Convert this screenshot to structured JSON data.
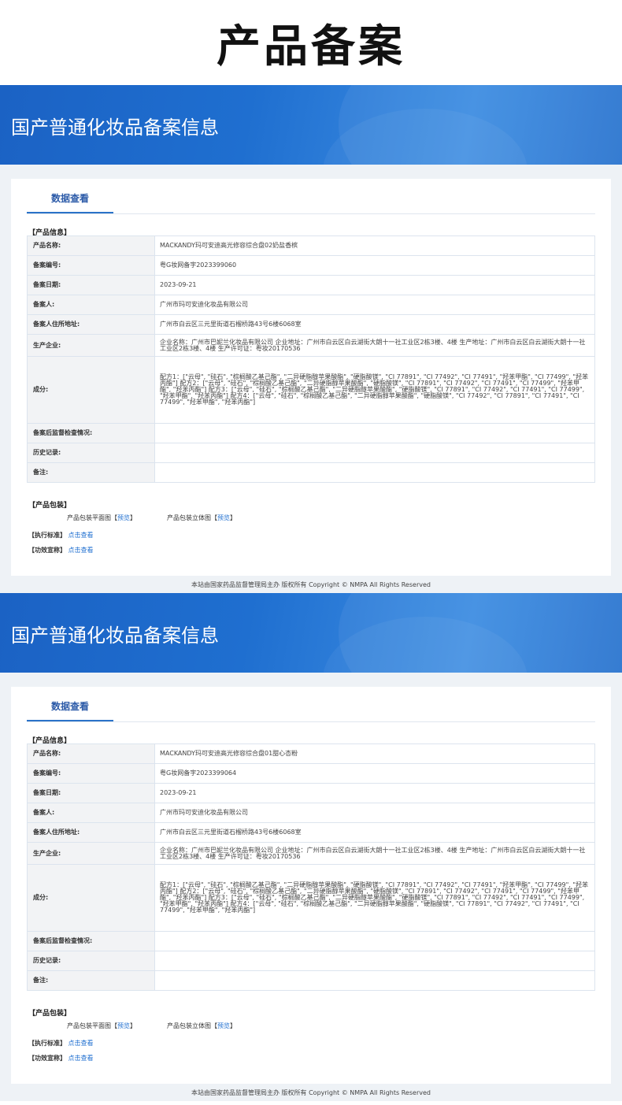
{
  "page_title": "产品备案",
  "records": [
    {
      "banner_title": "国产普通化妆品备案信息",
      "tab": "数据查看",
      "section_info": "【产品信息】",
      "rows": [
        {
          "label": "产品名称:",
          "value": "MACKANDY玛可安迪高光修容综合盘02奶盐香槟"
        },
        {
          "label": "备案编号:",
          "value": "粤G妆网备字2023399060"
        },
        {
          "label": "备案日期:",
          "value": "2023-09-21"
        },
        {
          "label": "备案人:",
          "value": "广州市玛可安迪化妆品有限公司"
        },
        {
          "label": "备案人住所地址:",
          "value": "广州市白云区三元里街道石榴桥路43号6楼6068室"
        },
        {
          "label": "生产企业:",
          "value": "企业名称：广州市巴妮兰化妆品有限公司 企业地址：广州市白云区白云湖街大朗十一社工业区2栋3楼、4楼 生产地址：广州市白云区白云湖街大朗十一社工业区2栋3楼、4楼 生产许可证：粤妆20170536"
        },
        {
          "label": "成分:",
          "value": "配方1：[\"云母\", \"硅石\", \"棕榈酸乙基己酯\", \"二异硬脂醇苹果酸酯\", \"硬脂酸镁\", \"CI 77891\", \"CI 77492\", \"CI 77491\", \"羟苯甲酯\", \"CI 77499\", \"羟苯丙酯\"] 配方2：[\"云母\", \"硅石\", \"棕榈酸乙基己酯\", \"二异硬脂醇苹果酸酯\", \"硬脂酸镁\", \"CI 77891\", \"CI 77492\", \"CI 77491\", \"CI 77499\", \"羟苯甲酯\", \"羟苯丙酯\"] 配方3：[\"云母\", \"硅石\", \"棕榈酸乙基己酯\", \"二异硬脂醇苹果酸酯\", \"硬脂酸镁\", \"CI 77891\", \"CI 77492\", \"CI 77491\", \"CI 77499\", \"羟苯甲酯\", \"羟苯丙酯\"] 配方4：[\"云母\", \"硅石\", \"棕榈酸乙基己酯\", \"二异硬脂醇苹果酸酯\", \"硬脂酸镁\", \"CI 77492\", \"CI 77891\", \"CI 77491\", \"CI 77499\", \"羟苯甲酯\", \"羟苯丙酯\"]"
        },
        {
          "label": "备案后监督检查情况:",
          "value": ""
        },
        {
          "label": "历史记录:",
          "value": ""
        },
        {
          "label": "备注:",
          "value": ""
        }
      ],
      "section_package": "【产品包装】",
      "package_flat": "产品包装平面图",
      "package_3d": "产品包装立体图",
      "bracket_open": "【",
      "bracket_close": "】",
      "preview": "预览",
      "standard_label": "【执行标准】",
      "efficacy_label": "【功效宣称】",
      "view_link": "点击查看",
      "footer": "本站由国家药品监督管理局主办 版权所有 Copyright © NMPA All Rights Reserved"
    },
    {
      "banner_title": "国产普通化妆品备案信息",
      "tab": "数据查看",
      "section_info": "【产品信息】",
      "rows": [
        {
          "label": "产品名称:",
          "value": "MACKANDY玛可安迪高光修容综合盘01甜心杏粉"
        },
        {
          "label": "备案编号:",
          "value": "粤G妆网备字2023399064"
        },
        {
          "label": "备案日期:",
          "value": "2023-09-21"
        },
        {
          "label": "备案人:",
          "value": "广州市玛可安迪化妆品有限公司"
        },
        {
          "label": "备案人住所地址:",
          "value": "广州市白云区三元里街道石榴桥路43号6楼6068室"
        },
        {
          "label": "生产企业:",
          "value": "企业名称：广州市巴妮兰化妆品有限公司 企业地址：广州市白云区白云湖街大朗十一社工业区2栋3楼、4楼 生产地址：广州市白云区白云湖街大朗十一社工业区2栋3楼、4楼 生产许可证：粤妆20170536"
        },
        {
          "label": "成分:",
          "value": "配方1：[\"云母\", \"硅石\", \"棕榈酸乙基己酯\", \"二异硬脂醇苹果酸酯\", \"硬脂酸镁\", \"CI 77891\", \"CI 77492\", \"CI 77491\", \"羟苯甲酯\", \"CI 77499\", \"羟苯丙酯\"] 配方2：[\"云母\", \"硅石\", \"棕榈酸乙基己酯\", \"二异硬脂醇苹果酸酯\", \"硬脂酸镁\", \"CI 77891\", \"CI 77492\", \"CI 77491\", \"CI 77499\", \"羟苯甲酯\", \"羟苯丙酯\"] 配方3：[\"云母\", \"硅石\", \"棕榈酸乙基己酯\", \"二异硬脂醇苹果酸酯\", \"硬脂酸镁\", \"CI 77891\", \"CI 77492\", \"CI 77491\", \"CI 77499\", \"羟苯甲酯\", \"羟苯丙酯\"] 配方4：[\"云母\", \"硅石\", \"棕榈酸乙基己酯\", \"二异硬脂醇苹果酸酯\", \"硬脂酸镁\", \"CI 77891\", \"CI 77492\", \"CI 77491\", \"CI 77499\", \"羟苯甲酯\", \"羟苯丙酯\"]"
        },
        {
          "label": "备案后监督检查情况:",
          "value": ""
        },
        {
          "label": "历史记录:",
          "value": ""
        },
        {
          "label": "备注:",
          "value": ""
        }
      ],
      "section_package": "【产品包装】",
      "package_flat": "产品包装平面图",
      "package_3d": "产品包装立体图",
      "bracket_open": "【",
      "bracket_close": "】",
      "preview": "预览",
      "standard_label": "【执行标准】",
      "efficacy_label": "【功效宣称】",
      "view_link": "点击查看",
      "footer": "本站由国家药品监督管理局主办 版权所有 Copyright © NMPA All Rights Reserved"
    }
  ]
}
